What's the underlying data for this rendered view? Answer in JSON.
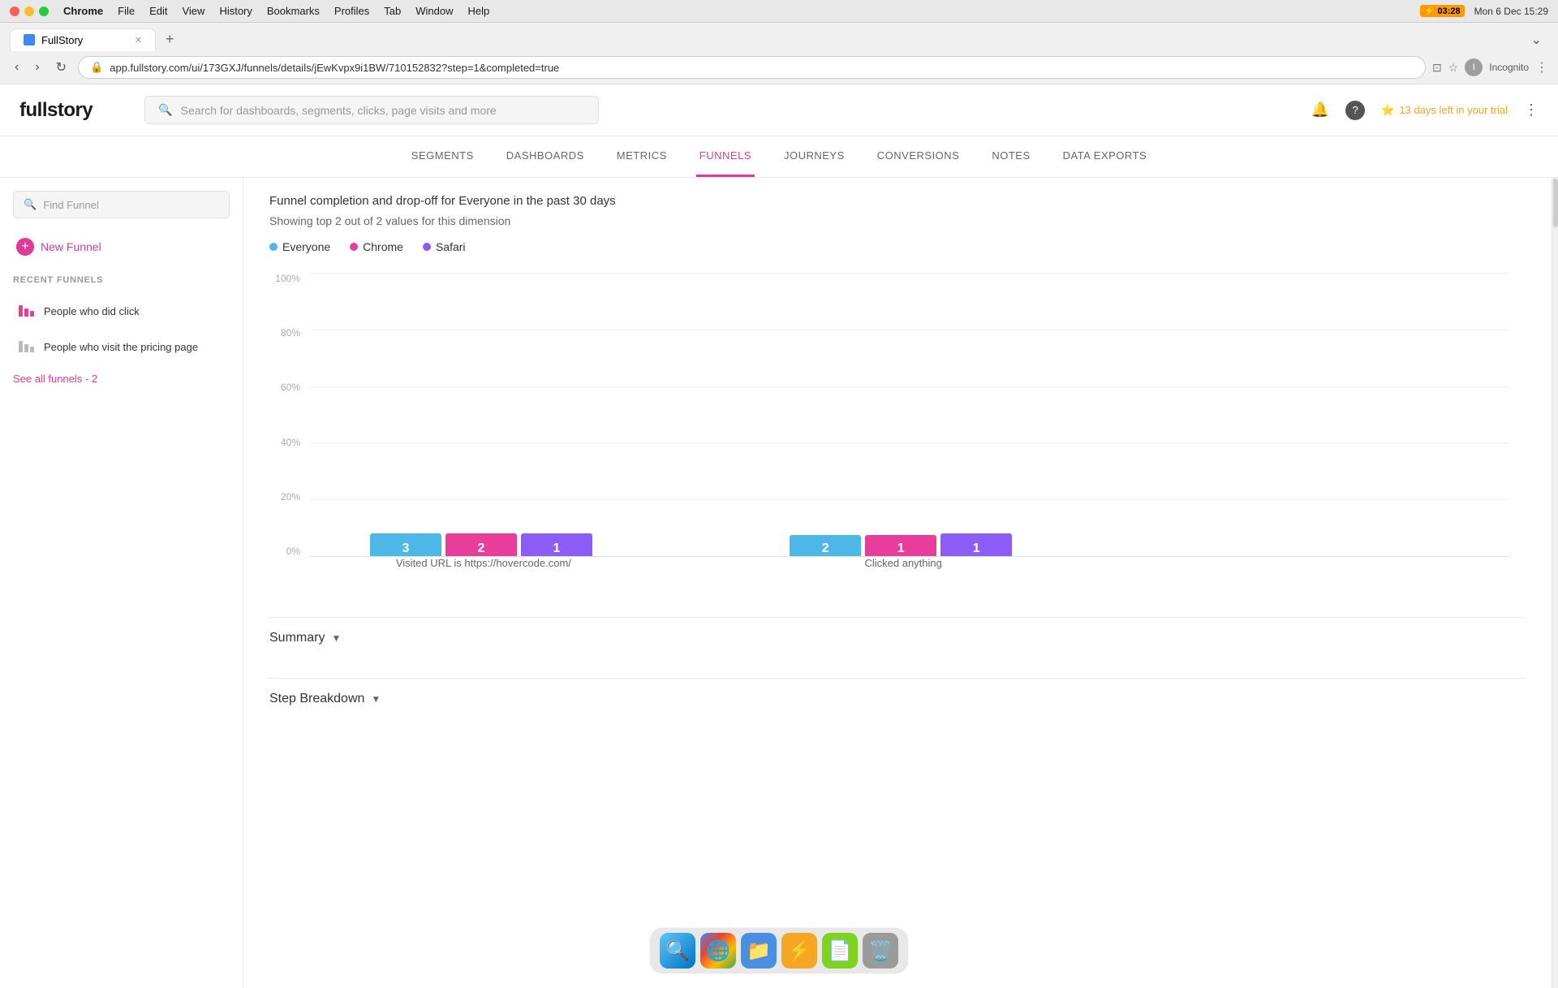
{
  "titlebar": {
    "app_name": "Chrome",
    "menu_items": [
      "Chrome",
      "File",
      "Edit",
      "View",
      "History",
      "Bookmarks",
      "Profiles",
      "Tab",
      "Window",
      "Help"
    ],
    "time": "Mon 6 Dec  15:29",
    "battery": "03:28"
  },
  "browser": {
    "tab_title": "FullStory",
    "url": "app.fullstory.com/ui/173GXJ/funnels/details/jEwKvpx9i1BW/710152832?step=1&completed=true",
    "profile": "Incognito"
  },
  "header": {
    "logo": "fullstory",
    "search_placeholder": "Search for dashboards, segments, clicks, page visits and more",
    "trial_text": "13 days left in your trial"
  },
  "nav": {
    "items": [
      "SEGMENTS",
      "DASHBOARDS",
      "METRICS",
      "FUNNELS",
      "JOURNEYS",
      "CONVERSIONS",
      "NOTES",
      "DATA EXPORTS"
    ],
    "active": "FUNNELS"
  },
  "sidebar": {
    "search_placeholder": "Find Funnel",
    "new_funnel_label": "New Funnel",
    "recent_label": "RECENT FUNNELS",
    "funnels": [
      {
        "name": "People who did click",
        "active": true
      },
      {
        "name": "People who visit the pricing page",
        "active": false
      }
    ],
    "see_all": "See all funnels - 2"
  },
  "funnel": {
    "subtitle": "Funnel completion and drop-off for Everyone in the past 30 days",
    "dimension_info": "Showing top 2 out of 2 values for this dimension",
    "legend": [
      {
        "label": "Everyone",
        "color": "#4db8e8"
      },
      {
        "label": "Chrome",
        "color": "#e83d9a"
      },
      {
        "label": "Safari",
        "color": "#8b5cf6"
      }
    ],
    "y_axis": [
      "100%",
      "80%",
      "60%",
      "40%",
      "20%",
      "0%"
    ],
    "steps": [
      {
        "label": "Visited URL is https://hovercode.com/",
        "bars": [
          {
            "type": "everyone",
            "value": 3,
            "height_pct": 100,
            "color": "#4db8e8"
          },
          {
            "type": "chrome",
            "value": 2,
            "height_pct": 100,
            "color": "#e83d9a"
          },
          {
            "type": "safari",
            "value": 1,
            "height_pct": 100,
            "color": "#8b5cf6"
          }
        ]
      },
      {
        "label": "Clicked anything",
        "bars": [
          {
            "type": "everyone-top",
            "value": null,
            "height_pct": 30,
            "color": "#b3e0f5"
          },
          {
            "type": "everyone",
            "value": 2,
            "height_pct": 70,
            "color": "#4db8e8"
          },
          {
            "type": "chrome-top",
            "value": null,
            "height_pct": 60,
            "color": "#f5b8d8"
          },
          {
            "type": "chrome",
            "value": 1,
            "height_pct": 40,
            "color": "#e83d9a"
          },
          {
            "type": "safari",
            "value": 1,
            "height_pct": 100,
            "color": "#8b5cf6"
          }
        ]
      }
    ],
    "summary_label": "Summary",
    "step_breakdown_label": "Step Breakdown"
  },
  "dock": {
    "icons": [
      "🔍",
      "🌐",
      "📁",
      "⚡",
      "📄",
      "🗑️"
    ]
  }
}
